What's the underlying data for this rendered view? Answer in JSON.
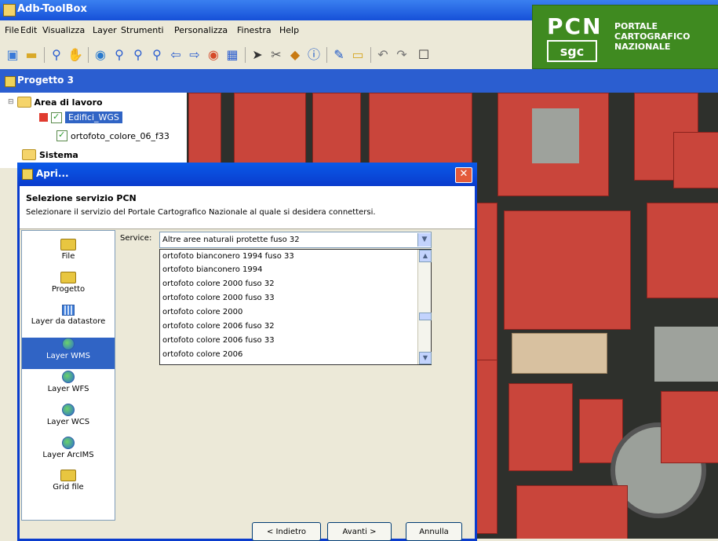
{
  "app": {
    "title": "Adb-ToolBox"
  },
  "menu": [
    "File",
    "Edit",
    "Visualizza",
    "Layer",
    "Strumenti",
    "Personalizza",
    "Finestra",
    "Help"
  ],
  "toolbar": {
    "icons": [
      "new-map-icon",
      "open-folder-icon",
      "zoom-tool-icon",
      "pan-hand-icon",
      "globe-icon",
      "zoom-in-icon",
      "zoom-out-icon",
      "zoom-extent-icon",
      "back-arrow-icon",
      "forward-arrow-icon",
      "layers-globe-icon",
      "table-icon",
      "select-pointer-icon",
      "tools-icon",
      "package-icon",
      "info-icon",
      "edit-icon",
      "ruler-icon",
      "undo-icon",
      "redo-icon",
      "window-icon"
    ]
  },
  "logo": {
    "big": "PCN",
    "small": "sgc",
    "right_line1": "PORTALE",
    "right_line2": "CARTOGRAFICO",
    "right_line3": "NAZIONALE"
  },
  "project": {
    "title": "Progetto 3"
  },
  "tree": {
    "workarea": "Area di lavoro",
    "layer1": "Edifici_WGS",
    "layer2": "ortofoto_colore_06_f33",
    "system": "Sistema"
  },
  "dialog": {
    "title": "Apri...",
    "heading": "Selezione servizio PCN",
    "description": "Selezionare il servizio del Portale Cartografico Nazionale al quale si desidera connettersi.",
    "side_items": [
      "File",
      "Progetto",
      "Layer da datastore",
      "Layer WMS",
      "Layer WFS",
      "Layer WCS",
      "Layer ArcIMS",
      "Grid file"
    ],
    "active_side": "Layer WMS",
    "service_label": "Service:",
    "service_value": "Altre aree naturali protette fuso 32",
    "options": [
      "ortofoto bianconero 1994 fuso 33",
      "ortofoto bianconero 1994",
      "ortofoto colore 2000 fuso 32",
      "ortofoto colore 2000 fuso 33",
      "ortofoto colore 2000",
      "ortofoto colore 2006 fuso 32",
      "ortofoto colore 2006 fuso 33",
      "ortofoto colore 2006"
    ],
    "back_button": "< Indietro",
    "next_button": "Avanti >",
    "cancel_button": "Annulla"
  }
}
